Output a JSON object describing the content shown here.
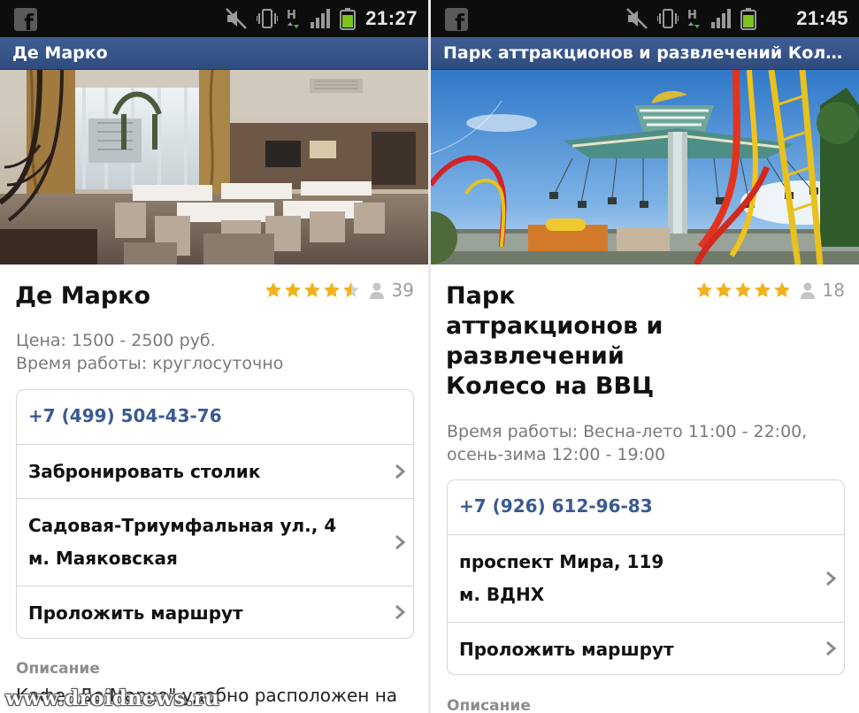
{
  "left": {
    "status": {
      "time": "21:27",
      "network": "H"
    },
    "title_bar": "Де Марко",
    "name": "Де Марко",
    "rating": {
      "stars": 4.5,
      "reviews": "39"
    },
    "info": [
      "Цена: 1500 - 2500 руб.",
      "Время работы: круглосуточно"
    ],
    "actions": {
      "phone": "+7 (499) 504-43-76",
      "book": "Забронировать столик",
      "address_line1": "Садовая-Триумфальная ул., 4",
      "address_line2": "м. Маяковская",
      "route": "Проложить маршрут"
    },
    "description_label": "Описание",
    "description_text": "Кафе \"Де Марко\" удобно расположен на",
    "watermark": "www.droidnews.ru"
  },
  "right": {
    "status": {
      "time": "21:45",
      "network": "H"
    },
    "title_bar": "Парк аттракционов и развлечений Колесо на ВВЦ",
    "name_lines": [
      "Парк",
      "аттракционов и",
      "развлечений",
      "Колесо на ВВЦ"
    ],
    "rating": {
      "stars": 5,
      "reviews": "18"
    },
    "info": [
      "Время работы: Весна-лето 11:00 - 22:00,",
      "осень-зима 12:00 - 19:00"
    ],
    "actions": {
      "phone": "+7 (926) 612-96-83",
      "address_line1": "проспект Мира, 119",
      "address_line2": "м. ВДНХ",
      "route": "Проложить маршрут"
    },
    "description_label": "Описание"
  },
  "colors": {
    "title_bar": "#34518a",
    "star": "#f1b21d",
    "link": "#3a5a94"
  }
}
